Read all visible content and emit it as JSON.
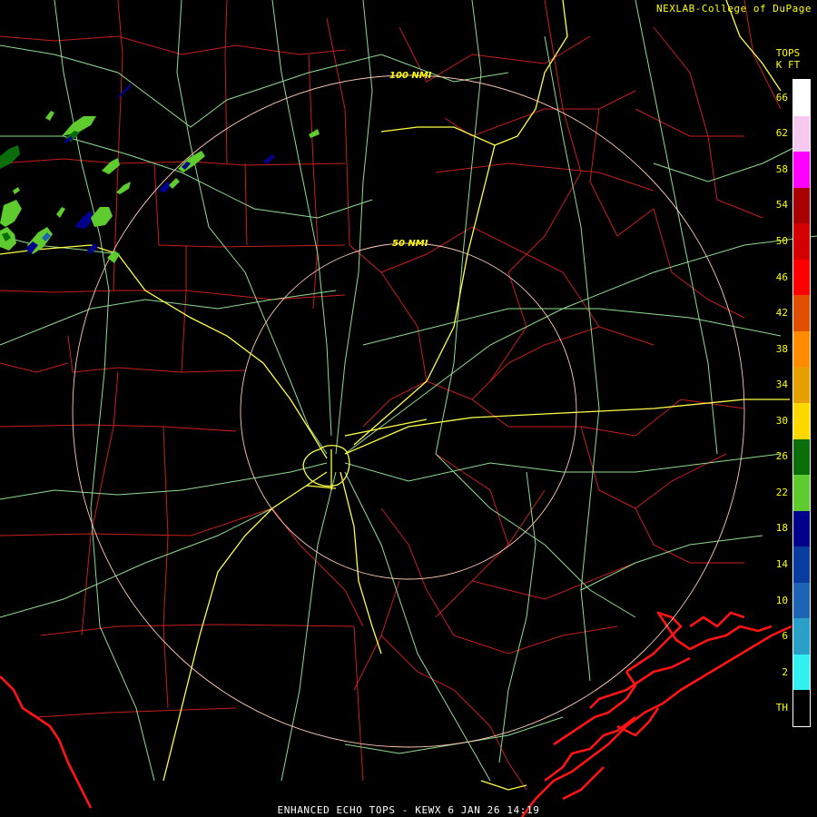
{
  "header": {
    "credit": "NEXLAB-College of DuPage",
    "legend_title": "TOPS",
    "legend_units": "K FT"
  },
  "footer": {
    "caption": "ENHANCED ECHO TOPS - KEWX 6 JAN 26 14:19"
  },
  "range_rings": [
    {
      "label": "50 NMI"
    },
    {
      "label": "100 NMI"
    }
  ],
  "legend": {
    "entries": [
      {
        "label": "66",
        "color": "#ffffff"
      },
      {
        "label": "62",
        "color": "#f7c8f0"
      },
      {
        "label": "58",
        "color": "#ff00ff"
      },
      {
        "label": "54",
        "color": "#a80000"
      },
      {
        "label": "50",
        "color": "#d40000"
      },
      {
        "label": "46",
        "color": "#ff0000"
      },
      {
        "label": "42",
        "color": "#e05000"
      },
      {
        "label": "38",
        "color": "#ff8c00"
      },
      {
        "label": "34",
        "color": "#e6a000"
      },
      {
        "label": "30",
        "color": "#ffd800"
      },
      {
        "label": "26",
        "color": "#0a6e0a"
      },
      {
        "label": "22",
        "color": "#5ecb2e"
      },
      {
        "label": "18",
        "color": "#00008c"
      },
      {
        "label": "14",
        "color": "#0a3ca0"
      },
      {
        "label": "10",
        "color": "#1e64b4"
      },
      {
        "label": "6",
        "color": "#28a0c8"
      },
      {
        "label": "2",
        "color": "#32f0f0"
      },
      {
        "label": "TH",
        "color": "#000000"
      }
    ]
  },
  "map_colors": {
    "county_lines": "#c81e1e",
    "highways": "#8fdc8f",
    "interstates": "#ffff46",
    "coastline": "#ff1414",
    "range_rings": "#ffc8b4"
  }
}
